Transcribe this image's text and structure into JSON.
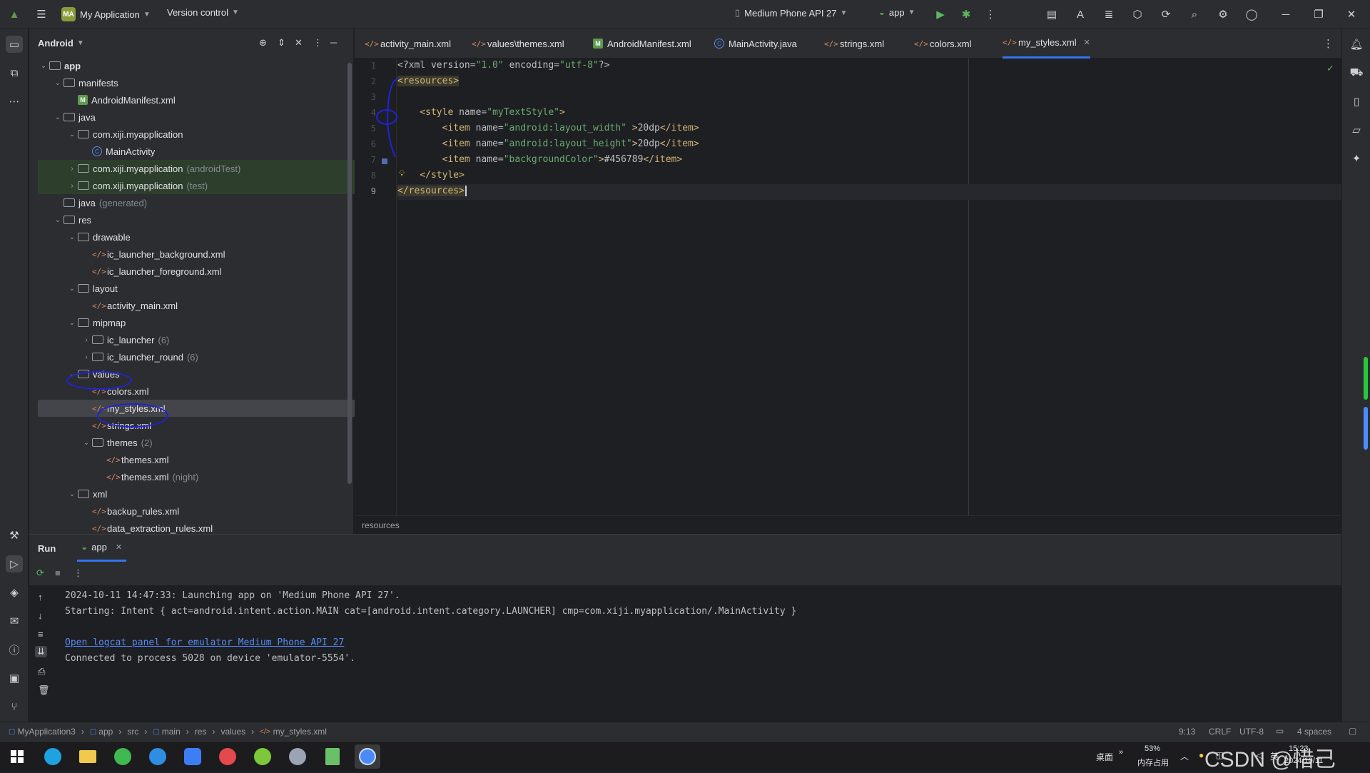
{
  "titlebar": {
    "project_badge": "MA",
    "project_name": "My Application",
    "vcs": "Version control",
    "device": "Medium Phone API 27",
    "run_config": "app"
  },
  "project_panel": {
    "view": "Android",
    "tree": [
      {
        "label": "app",
        "indent": 0,
        "kind": "module",
        "arrow": "open",
        "bold": true
      },
      {
        "label": "manifests",
        "indent": 1,
        "kind": "folder",
        "arrow": "open"
      },
      {
        "label": "AndroidManifest.xml",
        "indent": 2,
        "kind": "manifest"
      },
      {
        "label": "java",
        "indent": 1,
        "kind": "folder",
        "arrow": "open"
      },
      {
        "label": "com.xiji.myapplication",
        "indent": 2,
        "kind": "package",
        "arrow": "open"
      },
      {
        "label": "MainActivity",
        "indent": 3,
        "kind": "class"
      },
      {
        "label": "com.xiji.myapplication",
        "hint": "(androidTest)",
        "indent": 2,
        "kind": "package",
        "arrow": "closed",
        "highlight": true
      },
      {
        "label": "com.xiji.myapplication",
        "hint": "(test)",
        "indent": 2,
        "kind": "package",
        "arrow": "closed",
        "highlight": true
      },
      {
        "label": "java",
        "hint": "(generated)",
        "indent": 1,
        "kind": "folder"
      },
      {
        "label": "res",
        "indent": 1,
        "kind": "folder",
        "arrow": "open"
      },
      {
        "label": "drawable",
        "indent": 2,
        "kind": "folder",
        "arrow": "open"
      },
      {
        "label": "ic_launcher_background.xml",
        "indent": 3,
        "kind": "xml"
      },
      {
        "label": "ic_launcher_foreground.xml",
        "indent": 3,
        "kind": "xml"
      },
      {
        "label": "layout",
        "indent": 2,
        "kind": "folder",
        "arrow": "open"
      },
      {
        "label": "activity_main.xml",
        "indent": 3,
        "kind": "xml"
      },
      {
        "label": "mipmap",
        "indent": 2,
        "kind": "folder",
        "arrow": "open"
      },
      {
        "label": "ic_launcher",
        "hint": "(6)",
        "indent": 3,
        "kind": "folder",
        "arrow": "closed"
      },
      {
        "label": "ic_launcher_round",
        "hint": "(6)",
        "indent": 3,
        "kind": "folder",
        "arrow": "closed"
      },
      {
        "label": "values",
        "indent": 2,
        "kind": "folder",
        "arrow": "open"
      },
      {
        "label": "colors.xml",
        "indent": 3,
        "kind": "xml"
      },
      {
        "label": "my_styles.xml",
        "indent": 3,
        "kind": "xml",
        "selected": true
      },
      {
        "label": "strings.xml",
        "indent": 3,
        "kind": "xml"
      },
      {
        "label": "themes",
        "hint": "(2)",
        "indent": 3,
        "kind": "folder",
        "arrow": "open"
      },
      {
        "label": "themes.xml",
        "indent": 4,
        "kind": "xml"
      },
      {
        "label": "themes.xml",
        "hint": "(night)",
        "indent": 4,
        "kind": "xml"
      },
      {
        "label": "xml",
        "indent": 2,
        "kind": "folder",
        "arrow": "open"
      },
      {
        "label": "backup_rules.xml",
        "indent": 3,
        "kind": "xml"
      },
      {
        "label": "data_extraction_rules.xml",
        "indent": 3,
        "kind": "xml"
      }
    ]
  },
  "tabs": [
    {
      "label": "activity_main.xml",
      "kind": "xml"
    },
    {
      "label": "values\\themes.xml",
      "kind": "xml"
    },
    {
      "label": "AndroidManifest.xml",
      "kind": "manifest"
    },
    {
      "label": "MainActivity.java",
      "kind": "class"
    },
    {
      "label": "strings.xml",
      "kind": "xml"
    },
    {
      "label": "colors.xml",
      "kind": "xml"
    },
    {
      "label": "my_styles.xml",
      "kind": "xml",
      "active": true
    }
  ],
  "editor": {
    "line_numbers": [
      "1",
      "2",
      "3",
      "4",
      "5",
      "6",
      "7",
      "8",
      "9"
    ],
    "lines": [
      [
        {
          "t": "pi",
          "s": "<?xml version="
        },
        {
          "t": "val",
          "s": "\"1.0\""
        },
        {
          "t": "pi",
          "s": " encoding="
        },
        {
          "t": "val",
          "s": "\"utf-8\""
        },
        {
          "t": "pi",
          "s": "?>"
        }
      ],
      [
        {
          "t": "tag",
          "s": "<resources>"
        }
      ],
      [],
      [
        {
          "t": "pad",
          "s": "    "
        },
        {
          "t": "tag",
          "s": "<style "
        },
        {
          "t": "attr",
          "s": "name="
        },
        {
          "t": "val",
          "s": "\"myTextStyle\""
        },
        {
          "t": "tag",
          "s": ">"
        }
      ],
      [
        {
          "t": "pad",
          "s": "        "
        },
        {
          "t": "tag",
          "s": "<item "
        },
        {
          "t": "attr",
          "s": "name="
        },
        {
          "t": "val",
          "s": "\"android:layout_width\""
        },
        {
          "t": "tag",
          "s": " >"
        },
        {
          "t": "attr",
          "s": "20dp"
        },
        {
          "t": "tag",
          "s": "</item>"
        }
      ],
      [
        {
          "t": "pad",
          "s": "        "
        },
        {
          "t": "tag",
          "s": "<item "
        },
        {
          "t": "attr",
          "s": "name="
        },
        {
          "t": "val",
          "s": "\"android:layout_height\""
        },
        {
          "t": "tag",
          "s": ">"
        },
        {
          "t": "attr",
          "s": "20dp"
        },
        {
          "t": "tag",
          "s": "</item>"
        }
      ],
      [
        {
          "t": "pad",
          "s": "        "
        },
        {
          "t": "tag",
          "s": "<item "
        },
        {
          "t": "attr",
          "s": "name="
        },
        {
          "t": "val",
          "s": "\"backgroundColor\""
        },
        {
          "t": "tag",
          "s": ">"
        },
        {
          "t": "attr",
          "s": "#456789"
        },
        {
          "t": "tag",
          "s": "</item>"
        }
      ],
      [
        {
          "t": "pad",
          "s": "    "
        },
        {
          "t": "tag",
          "s": "</style>"
        }
      ],
      [
        {
          "t": "tag",
          "s": "</resources>"
        }
      ]
    ],
    "breadcrumb": "resources"
  },
  "run_panel": {
    "title": "Run",
    "tab": "app",
    "console": [
      "2024-10-11 14:47:33: Launching app on 'Medium Phone API 27'.",
      "Starting: Intent { act=android.intent.action.MAIN cat=[android.intent.category.LAUNCHER] cmp=com.xiji.myapplication/.MainActivity }",
      "",
      "Open logcat panel for emulator Medium Phone API 27",
      "Connected to process 5028 on device 'emulator-5554'."
    ]
  },
  "statusbar": {
    "path": [
      "MyApplication3",
      "app",
      "src",
      "main",
      "res",
      "values",
      "my_styles.xml"
    ],
    "position": "9:13",
    "line_sep": "CRLF",
    "encoding": "UTF-8",
    "indent": "4 spaces"
  },
  "taskbar": {
    "desktop_label": "桌面",
    "mem_percent": "53%",
    "mem_label": "内存占用",
    "ime": "英",
    "time": "15:23",
    "date": "2024/10/11",
    "watermark": "CSDN @惜己"
  },
  "colors": {
    "accent": "#3574f0",
    "annotation": "#2222d8"
  }
}
